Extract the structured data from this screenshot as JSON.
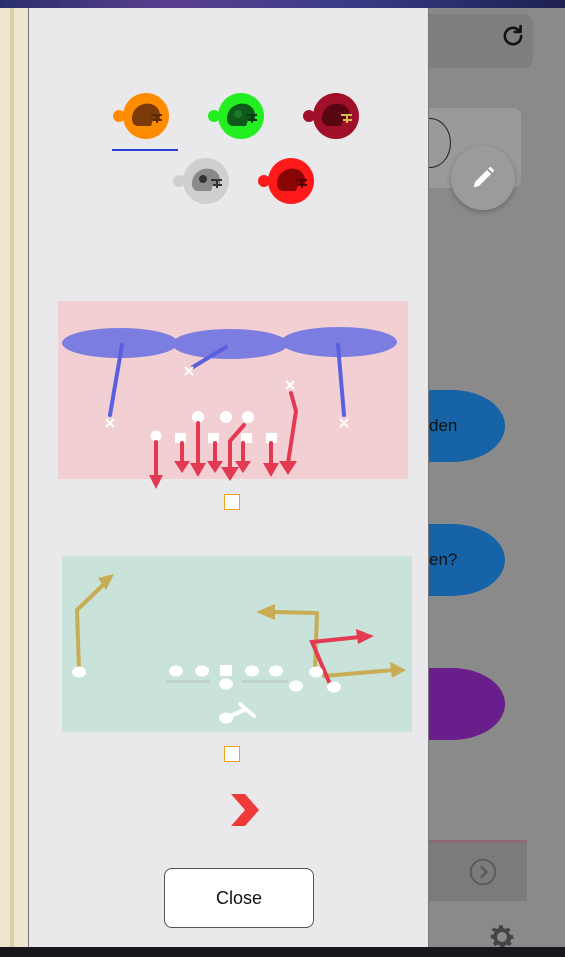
{
  "background_app": {
    "pill1_text": "den",
    "pill2_text": "en?",
    "pill3_text": "",
    "icons": [
      "refresh-icon",
      "pencil-icon",
      "send-icon",
      "gear-icon"
    ]
  },
  "team_picker": {
    "teams": [
      {
        "color": "#ff8c00",
        "icon": "helmet-icon"
      },
      {
        "color": "#22ee22",
        "icon": "helmet-icon"
      },
      {
        "color": "#a01028",
        "icon": "helmet-icon"
      },
      {
        "color": "#cfcfcf",
        "icon": "helmet-icon"
      },
      {
        "color": "#ff1a1a",
        "icon": "helmet-icon"
      }
    ],
    "selected_index": 0
  },
  "plays": [
    {
      "background": "#f2cfd2",
      "checked": false
    },
    {
      "background": "#c9e2da",
      "checked": false
    }
  ],
  "next_icon": "chevron-right-icon",
  "close_label": "Close"
}
